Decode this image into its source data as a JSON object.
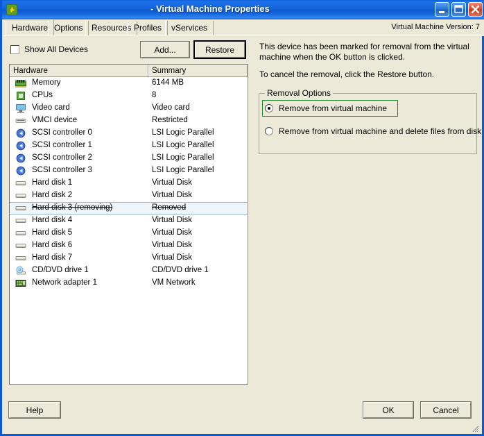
{
  "window": {
    "title": "- Virtual Machine Properties",
    "icon": "vm-properties-icon",
    "minimize_label": "minimize-icon",
    "maximize_label": "maximize-icon",
    "close_label": "close-icon"
  },
  "tabs": [
    {
      "label": "Hardware",
      "active": true
    },
    {
      "label": "Options",
      "active": false
    },
    {
      "label": "Resources",
      "active": false
    },
    {
      "label": "Profiles",
      "active": false
    },
    {
      "label": "vServices",
      "active": false
    }
  ],
  "vm_version": "Virtual Machine Version: 7",
  "toolbar": {
    "show_all_devices_label": "Show All Devices",
    "show_all_devices_checked": false,
    "add_label": "Add...",
    "restore_label": "Restore"
  },
  "hardware_list": {
    "columns": [
      "Hardware",
      "Summary"
    ],
    "rows": [
      {
        "icon": "memory-icon",
        "name": "Memory",
        "summary": "6144 MB",
        "selected": false,
        "removed": false
      },
      {
        "icon": "cpu-icon",
        "name": "CPUs",
        "summary": "8",
        "selected": false,
        "removed": false
      },
      {
        "icon": "video-card-icon",
        "name": "Video card",
        "summary": "Video card",
        "selected": false,
        "removed": false
      },
      {
        "icon": "vmci-device-icon",
        "name": "VMCI device",
        "summary": "Restricted",
        "selected": false,
        "removed": false
      },
      {
        "icon": "scsi-controller-icon",
        "name": "SCSI controller 0",
        "summary": "LSI Logic Parallel",
        "selected": false,
        "removed": false
      },
      {
        "icon": "scsi-controller-icon",
        "name": "SCSI controller 1",
        "summary": "LSI Logic Parallel",
        "selected": false,
        "removed": false
      },
      {
        "icon": "scsi-controller-icon",
        "name": "SCSI controller 2",
        "summary": "LSI Logic Parallel",
        "selected": false,
        "removed": false
      },
      {
        "icon": "scsi-controller-icon",
        "name": "SCSI controller 3",
        "summary": "LSI Logic Parallel",
        "selected": false,
        "removed": false
      },
      {
        "icon": "hard-disk-icon",
        "name": "Hard disk 1",
        "summary": "Virtual Disk",
        "selected": false,
        "removed": false
      },
      {
        "icon": "hard-disk-icon",
        "name": "Hard disk 2",
        "summary": "Virtual Disk",
        "selected": false,
        "removed": false
      },
      {
        "icon": "hard-disk-icon",
        "name": "Hard disk 3 (removing)",
        "summary": "Removed",
        "selected": true,
        "removed": true
      },
      {
        "icon": "hard-disk-icon",
        "name": "Hard disk 4",
        "summary": "Virtual Disk",
        "selected": false,
        "removed": false
      },
      {
        "icon": "hard-disk-icon",
        "name": "Hard disk 5",
        "summary": "Virtual Disk",
        "selected": false,
        "removed": false
      },
      {
        "icon": "hard-disk-icon",
        "name": "Hard disk 6",
        "summary": "Virtual Disk",
        "selected": false,
        "removed": false
      },
      {
        "icon": "hard-disk-icon",
        "name": "Hard disk 7",
        "summary": "Virtual Disk",
        "selected": false,
        "removed": false
      },
      {
        "icon": "cd-dvd-drive-icon",
        "name": "CD/DVD drive 1",
        "summary": "CD/DVD drive 1",
        "selected": false,
        "removed": false
      },
      {
        "icon": "network-adapter-icon",
        "name": "Network adapter 1",
        "summary": "VM Network",
        "selected": false,
        "removed": false
      }
    ]
  },
  "detail_panel": {
    "paragraph_1": "This device has been marked for removal from the virtual machine when the OK button is clicked.",
    "paragraph_2": "To cancel the removal, click the Restore button.",
    "group_title": "Removal Options",
    "options": [
      {
        "label": "Remove from virtual machine",
        "selected": true
      },
      {
        "label": "Remove from virtual machine and delete files from disk",
        "selected": false
      }
    ]
  },
  "footer": {
    "help_label": "Help",
    "ok_label": "OK",
    "cancel_label": "Cancel"
  },
  "colors": {
    "title_bar_blue": "#1565dc",
    "window_border": "#0a5ad6",
    "dialog_face": "#ece9d8",
    "selection_blue": "#eef5fb",
    "highlight_green": "#1e8a32"
  }
}
